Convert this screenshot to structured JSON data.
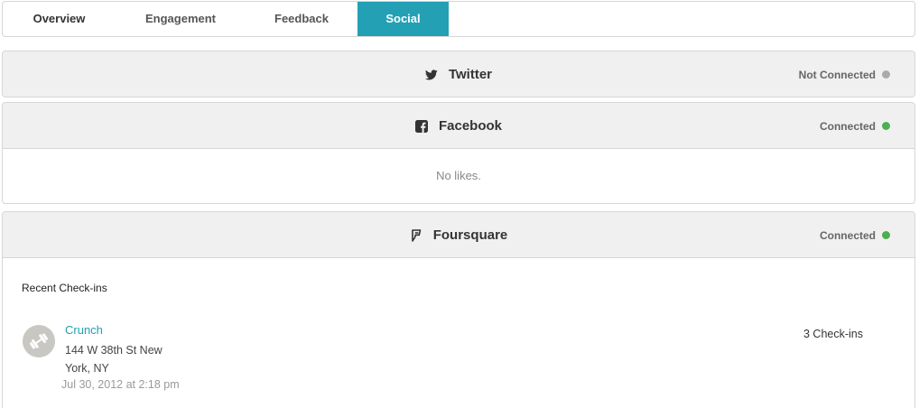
{
  "tabs": [
    {
      "label": "Overview"
    },
    {
      "label": "Engagement"
    },
    {
      "label": "Feedback"
    },
    {
      "label": "Social"
    }
  ],
  "active_tab": "Social",
  "accent_color": "#24a0b5",
  "status_colors": {
    "connected": "#4caf50",
    "not_connected": "#aaaaaa"
  },
  "panels": {
    "twitter": {
      "title": "Twitter",
      "icon": "twitter-icon",
      "status": "Not Connected"
    },
    "facebook": {
      "title": "Facebook",
      "icon": "facebook-icon",
      "status": "Connected",
      "empty_message": "No likes."
    },
    "foursquare": {
      "title": "Foursquare",
      "icon": "foursquare-icon",
      "status": "Connected",
      "section_title": "Recent Check-ins",
      "checkins": [
        {
          "venue": "Crunch",
          "icon": "dumbbell-icon",
          "address": "144 W 38th St New York, NY",
          "date": "Jul 30, 2012 at 2:18 pm",
          "count": "3 Check-ins"
        }
      ]
    }
  }
}
